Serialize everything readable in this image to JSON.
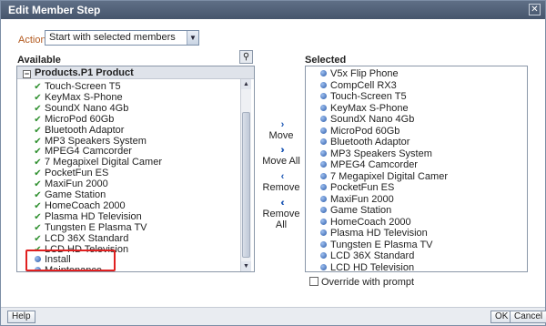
{
  "dialog": {
    "title": "Edit Member Step",
    "close_glyph": "✕"
  },
  "action": {
    "label": "Action",
    "selected": "Start with selected members"
  },
  "available": {
    "label": "Available",
    "root": "Products.P1  Product",
    "items": [
      {
        "label": "Touch-Screen T5",
        "icon": "check-member-icon"
      },
      {
        "label": "KeyMax S-Phone",
        "icon": "check-member-icon"
      },
      {
        "label": "SoundX Nano 4Gb",
        "icon": "check-member-icon"
      },
      {
        "label": "MicroPod 60Gb",
        "icon": "check-member-icon"
      },
      {
        "label": "Bluetooth Adaptor",
        "icon": "check-member-icon"
      },
      {
        "label": "MP3 Speakers System",
        "icon": "check-member-icon"
      },
      {
        "label": "MPEG4 Camcorder",
        "icon": "check-member-icon"
      },
      {
        "label": "7 Megapixel Digital Camer",
        "icon": "check-member-icon"
      },
      {
        "label": "PocketFun ES",
        "icon": "check-member-icon"
      },
      {
        "label": "MaxiFun 2000",
        "icon": "check-member-icon"
      },
      {
        "label": "Game Station",
        "icon": "check-member-icon"
      },
      {
        "label": "HomeCoach 2000",
        "icon": "check-member-icon"
      },
      {
        "label": "Plasma HD Television",
        "icon": "check-member-icon"
      },
      {
        "label": "Tungsten E Plasma TV",
        "icon": "check-member-icon"
      },
      {
        "label": "LCD 36X Standard",
        "icon": "check-member-icon"
      },
      {
        "label": "LCD HD Television",
        "icon": "check-member-icon"
      },
      {
        "label": "Install",
        "icon": "member-dot-icon"
      },
      {
        "label": "Maintenance",
        "icon": "member-dot-icon"
      }
    ]
  },
  "move_buttons": {
    "move": "Move",
    "move_all": "Move All",
    "remove": "Remove",
    "remove_all": "Remove All"
  },
  "selected": {
    "label": "Selected",
    "items": [
      "V5x Flip Phone",
      "CompCell RX3",
      "Touch-Screen T5",
      "KeyMax S-Phone",
      "SoundX Nano 4Gb",
      "MicroPod 60Gb",
      "Bluetooth Adaptor",
      "MP3 Speakers System",
      "MPEG4 Camcorder",
      "7 Megapixel Digital Camer",
      "PocketFun ES",
      "MaxiFun 2000",
      "Game Station",
      "HomeCoach 2000",
      "Plasma HD Television",
      "Tungsten E Plasma TV",
      "LCD 36X Standard",
      "LCD HD Television"
    ]
  },
  "override": {
    "label": "Override with prompt",
    "checked": false
  },
  "footer": {
    "help": "Help",
    "ok": "OK",
    "cancel": "Cancel"
  },
  "colors": {
    "title_bar": "#4f5e76",
    "action_label": "#b35a1f",
    "highlight": "#e02020",
    "move_arrow": "#1e58b5"
  }
}
